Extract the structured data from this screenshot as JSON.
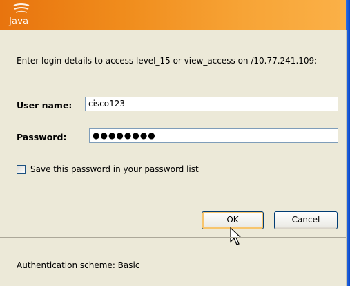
{
  "banner": {
    "brand": "Java"
  },
  "dialog": {
    "prompt": "Enter login details to access level_15 or view_access on /10.77.241.109:",
    "username_label": "User name:",
    "username_value": "cisco123",
    "password_label": "Password:",
    "password_masked": "●●●●●●●●",
    "save_label": "Save this password in your password list",
    "save_checked": false,
    "ok_label": "OK",
    "cancel_label": "Cancel",
    "status": "Authentication scheme: Basic"
  },
  "colors": {
    "banner_start": "#e8740e",
    "banner_end": "#fbb148",
    "dialog_bg": "#ece9d8",
    "field_border": "#7f9db9",
    "button_focus": "#f7c56e"
  },
  "icons": [
    "java-cup-icon",
    "mouse-pointer-icon",
    "checkbox-icon"
  ]
}
